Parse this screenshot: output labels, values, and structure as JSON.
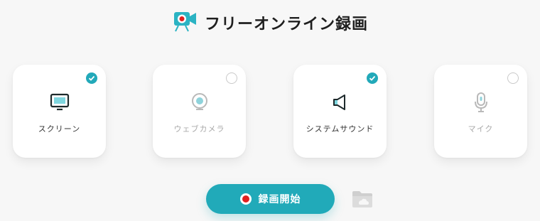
{
  "header": {
    "title": "フリーオンライン録画",
    "logo_icon": "camera-record-logo"
  },
  "sources": [
    {
      "label": "スクリーン",
      "checked": true,
      "icon": "monitor-icon"
    },
    {
      "label": "ウェブカメラ",
      "checked": false,
      "icon": "webcam-icon"
    },
    {
      "label": "システムサウンド",
      "checked": true,
      "icon": "speaker-icon"
    },
    {
      "label": "マイク",
      "checked": false,
      "icon": "microphone-icon"
    }
  ],
  "actions": {
    "record_label": "録画開始",
    "folder_icon": "folder-icon"
  },
  "colors": {
    "accent": "#21aab9",
    "record_dot": "#e02020",
    "inactive_text": "#a9a9a9"
  }
}
